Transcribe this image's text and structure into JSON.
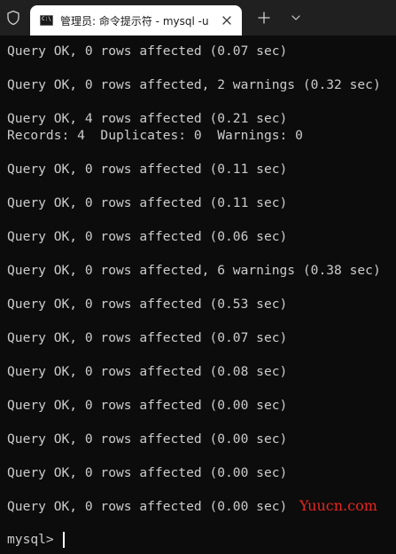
{
  "tabbar": {
    "shield_icon": "shield-icon",
    "tab_icon": "cmd-icon",
    "tab_title": "管理员: 命令提示符 - mysql  -u",
    "close_icon": "close-icon",
    "new_tab_icon": "plus-icon",
    "dropdown_icon": "chevron-down-icon"
  },
  "terminal": {
    "lines": [
      "Query OK, 0 rows affected (0.07 sec)",
      "Query OK, 0 rows affected, 2 warnings (0.32 sec)",
      "Query OK, 4 rows affected (0.21 sec)",
      "Records: 4  Duplicates: 0  Warnings: 0",
      "Query OK, 0 rows affected (0.11 sec)",
      "Query OK, 0 rows affected (0.11 sec)",
      "Query OK, 0 rows affected (0.06 sec)",
      "Query OK, 0 rows affected, 6 warnings (0.38 sec)",
      "Query OK, 0 rows affected (0.53 sec)",
      "Query OK, 0 rows affected (0.07 sec)",
      "Query OK, 0 rows affected (0.08 sec)",
      "Query OK, 0 rows affected (0.00 sec)",
      "Query OK, 0 rows affected (0.00 sec)",
      "Query OK, 0 rows affected (0.00 sec)",
      "Query OK, 0 rows affected (0.00 sec)"
    ],
    "prompt": "mysql> ",
    "watermark": "Yuucn.com"
  },
  "colors": {
    "background": "#0c0c0c",
    "text": "#cccccc",
    "tabbar": "#202020",
    "tab_active": "#ffffff",
    "watermark": "#e8261f"
  }
}
